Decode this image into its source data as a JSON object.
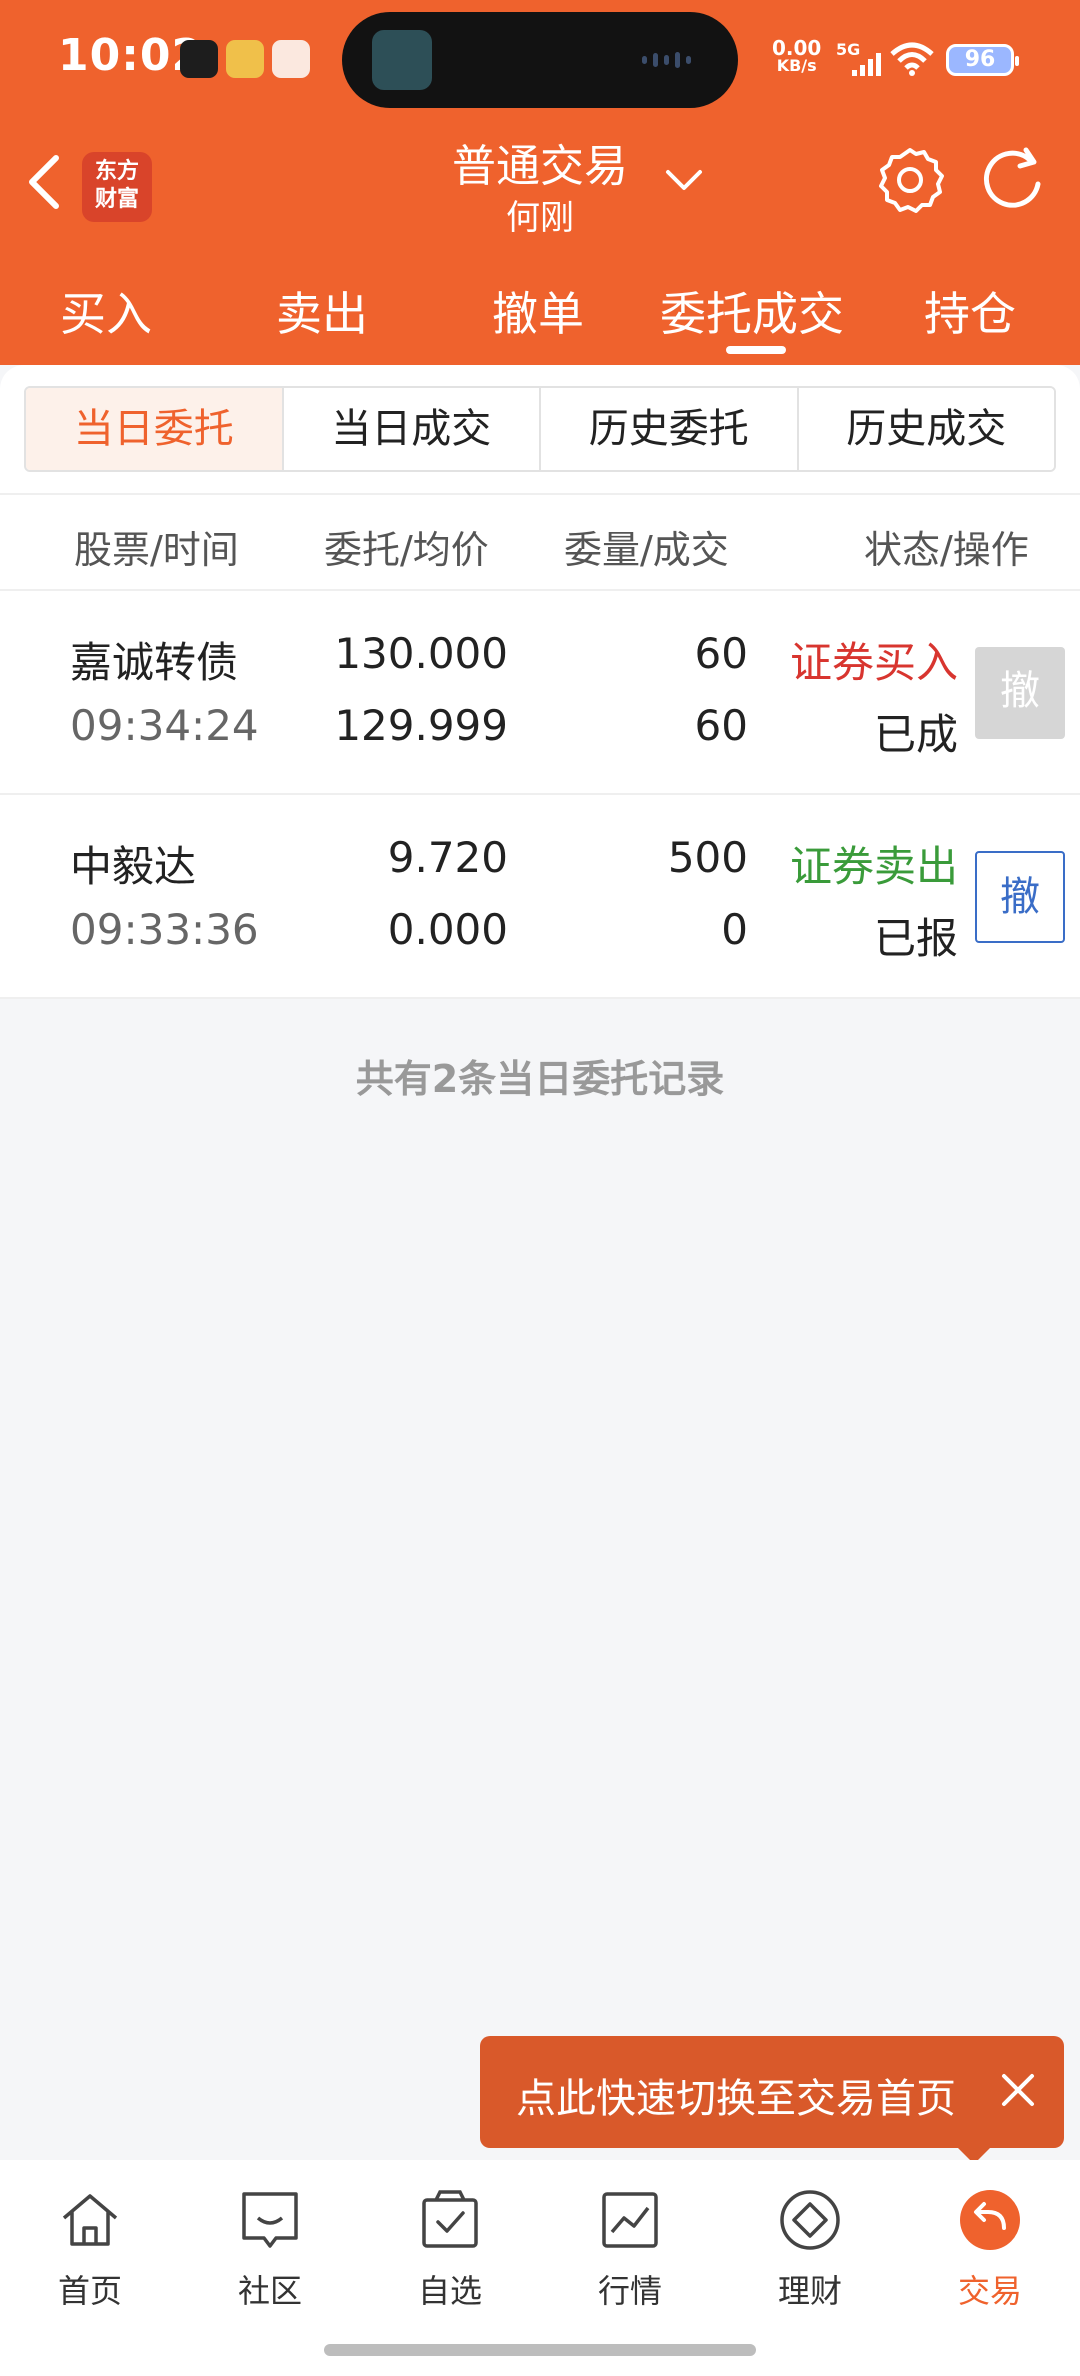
{
  "status_bar": {
    "time": "10:02",
    "net_speed": "0.00",
    "net_unit": "KB/s",
    "network": "5G",
    "battery": "96"
  },
  "nav": {
    "title": "普通交易",
    "subtitle": "何刚",
    "logo_text_1": "东方",
    "logo_text_2": "财富"
  },
  "tabs": [
    {
      "label": "买入"
    },
    {
      "label": "卖出"
    },
    {
      "label": "撤单"
    },
    {
      "label": "委托成交",
      "active": true
    },
    {
      "label": "持仓"
    }
  ],
  "segments": [
    {
      "label": "当日委托",
      "active": true
    },
    {
      "label": "当日成交"
    },
    {
      "label": "历史委托"
    },
    {
      "label": "历史成交"
    }
  ],
  "table_header": {
    "col1": "股票/时间",
    "col2": "委托/均价",
    "col3": "委量/成交",
    "col4": "状态/操作"
  },
  "orders": [
    {
      "name": "嘉诚转债",
      "time": "09:34:24",
      "price": "130.000",
      "avg": "129.999",
      "qty": "60",
      "filled": "60",
      "op": "证券买入",
      "op_color": "#d8352f",
      "state": "已成",
      "cancel": "撤",
      "cancel_enabled": false
    },
    {
      "name": "中毅达",
      "time": "09:33:36",
      "price": "9.720",
      "avg": "0.000",
      "qty": "500",
      "filled": "0",
      "op": "证券卖出",
      "op_color": "#3a9b3a",
      "state": "已报",
      "cancel": "撤",
      "cancel_enabled": true
    }
  ],
  "summary": "共有2条当日委托记录",
  "tooltip": {
    "text": "点此快速切换至交易首页"
  },
  "bottom_nav": [
    {
      "label": "首页",
      "icon": "home-icon"
    },
    {
      "label": "社区",
      "icon": "community-icon"
    },
    {
      "label": "自选",
      "icon": "watchlist-icon"
    },
    {
      "label": "行情",
      "icon": "market-icon"
    },
    {
      "label": "理财",
      "icon": "wealth-icon"
    },
    {
      "label": "交易",
      "icon": "trade-icon",
      "active": true
    }
  ],
  "colors": {
    "brand": "#ef622d",
    "buy": "#d8352f",
    "sell": "#3a9b3a",
    "cancel": "#3a6dc7"
  }
}
